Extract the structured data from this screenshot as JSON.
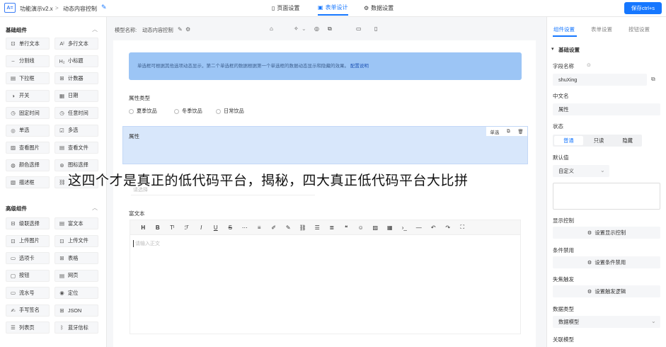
{
  "topbar": {
    "logo_text": "A=",
    "app_name": "功能演示v2.x",
    "separator": ">",
    "page_name": "动态内容控制",
    "tabs": [
      {
        "label": "页面设置",
        "icon": "page-icon"
      },
      {
        "label": "表单设计",
        "icon": "form-icon"
      },
      {
        "label": "数据设置",
        "icon": "data-icon"
      }
    ],
    "save_label": "保存ctrl+s"
  },
  "left_panel": {
    "basic_group_title": "基础组件",
    "basic_components": [
      {
        "label": "单行文本",
        "icon": "text-icon"
      },
      {
        "label": "多行文本",
        "icon": "multiline-icon"
      },
      {
        "label": "分割线",
        "icon": "divider-icon"
      },
      {
        "label": "小标题",
        "icon": "heading-icon"
      },
      {
        "label": "下拉框",
        "icon": "dropdown-icon"
      },
      {
        "label": "计数器",
        "icon": "counter-icon"
      },
      {
        "label": "开关",
        "icon": "switch-icon"
      },
      {
        "label": "日期",
        "icon": "calendar-icon"
      },
      {
        "label": "固定时间",
        "icon": "clock-icon"
      },
      {
        "label": "任意时间",
        "icon": "clock-icon"
      },
      {
        "label": "单选",
        "icon": "radio-icon"
      },
      {
        "label": "多选",
        "icon": "checkbox-icon"
      },
      {
        "label": "查看图片",
        "icon": "image-icon"
      },
      {
        "label": "查看文件",
        "icon": "file-icon"
      },
      {
        "label": "颜色选择",
        "icon": "palette-icon"
      },
      {
        "label": "图标选择",
        "icon": "icon-picker-icon"
      },
      {
        "label": "描述框",
        "icon": "description-icon"
      },
      {
        "label": "",
        "icon": "link-icon"
      }
    ],
    "advanced_group_title": "高级组件",
    "advanced_components": [
      {
        "label": "级联选择",
        "icon": "cascader-icon"
      },
      {
        "label": "富文本",
        "icon": "richtext-icon"
      },
      {
        "label": "上传图片",
        "icon": "upload-image-icon"
      },
      {
        "label": "上传文件",
        "icon": "upload-file-icon"
      },
      {
        "label": "选项卡",
        "icon": "tabs-icon"
      },
      {
        "label": "表格",
        "icon": "table-icon"
      },
      {
        "label": "按钮",
        "icon": "button-icon"
      },
      {
        "label": "网页",
        "icon": "webpage-icon"
      },
      {
        "label": "流水号",
        "icon": "serial-icon"
      },
      {
        "label": "定位",
        "icon": "location-icon"
      },
      {
        "label": "手写签名",
        "icon": "signature-icon"
      },
      {
        "label": "JSON",
        "icon": "json-icon"
      },
      {
        "label": "列表页",
        "icon": "list-page-icon"
      },
      {
        "label": "蓝牙信标",
        "icon": "bluetooth-icon"
      }
    ]
  },
  "canvas": {
    "model_label": "模型名称:",
    "model_name": "动态内容控制",
    "tip_text": "单选框可根据其他选项动态显示，第二个单选框的数据根据第一个单选框的数据动态显示和隐藏的效果。",
    "tip_link": "配置说明",
    "fields": {
      "attr_type_label": "属性类型",
      "attr_type_options": [
        "夏季饮品",
        "冬季饮品",
        "日常饮品"
      ],
      "attr_label": "属性",
      "field_tool_label": "单选",
      "input_placeholder": "请选择",
      "richtext_label": "富文本",
      "richtext_placeholder": "请输入正文"
    },
    "overlay_text": "这四个才是真正的低代码平台，揭秘，四大真正低代码平台大比拼"
  },
  "right_panel": {
    "tabs": [
      "组件设置",
      "表单设置",
      "按钮设置"
    ],
    "section_title": "基础设置",
    "field_name_label": "字段名称",
    "field_name_value": "shuXing",
    "cn_name_label": "中文名",
    "cn_name_value": "属性",
    "status_label": "状态",
    "status_options": [
      "普通",
      "只读",
      "隐藏"
    ],
    "default_label": "默认值",
    "default_value": "自定义",
    "display_control_label": "显示控制",
    "display_control_btn": "设置显示控制",
    "condition_disable_label": "条件禁用",
    "condition_disable_btn": "设置条件禁用",
    "focus_trigger_label": "失焦触发",
    "focus_trigger_btn": "设置触发逻辑",
    "data_type_label": "数据类型",
    "data_type_value": "数据模型",
    "related_model_label": "关联模型"
  }
}
